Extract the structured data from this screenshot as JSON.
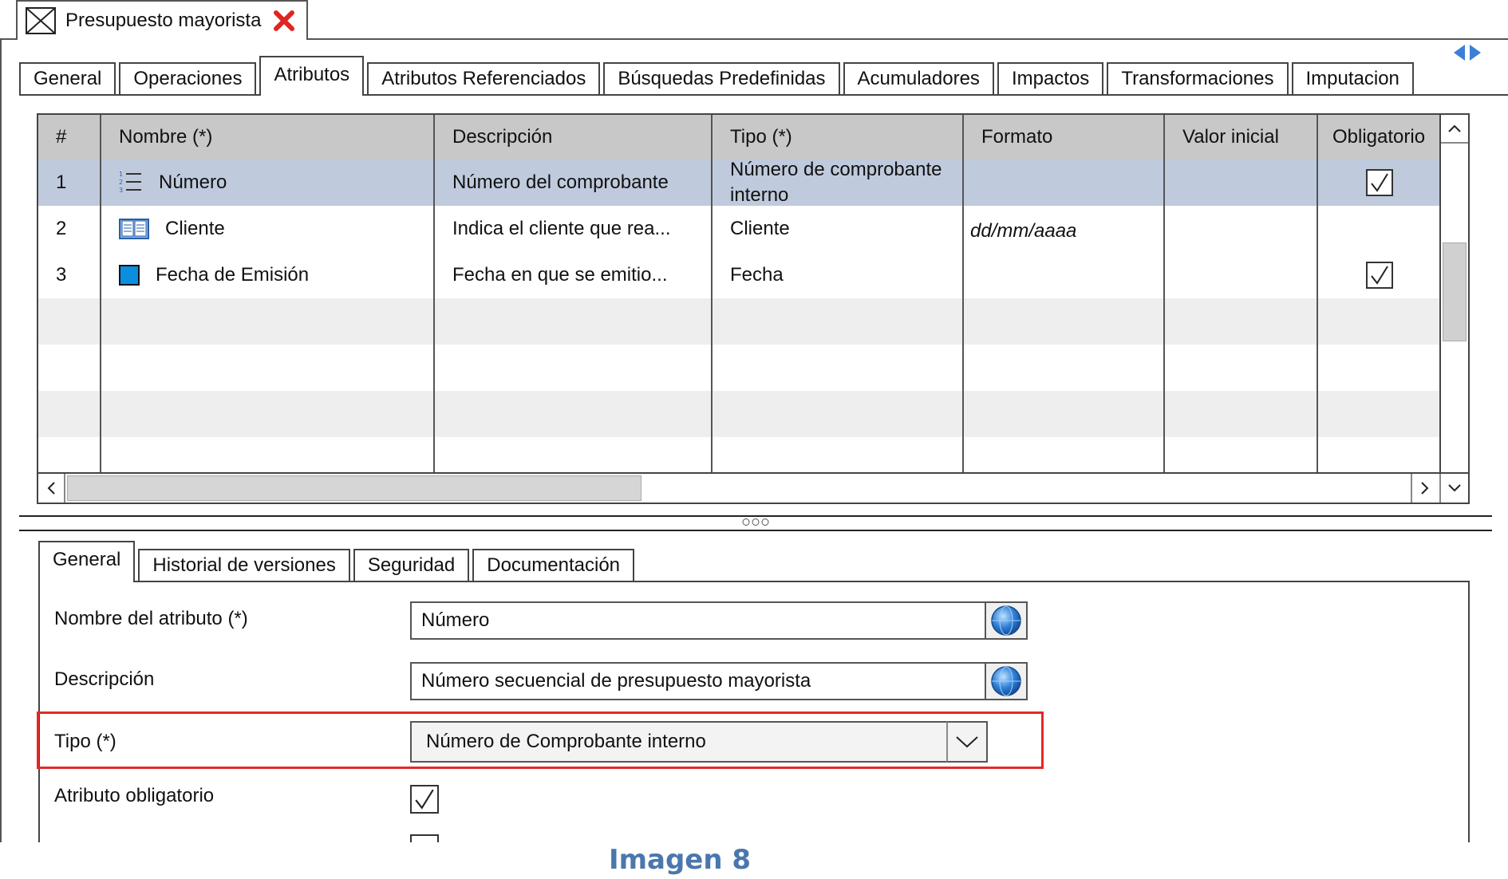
{
  "window": {
    "doc_title": "Presupuesto mayorista"
  },
  "tabs_top": [
    "General",
    "Operaciones",
    "Atributos",
    "Atributos Referenciados",
    "Búsquedas Predefinidas",
    "Acumuladores",
    "Impactos",
    "Transformaciones",
    "Imputacion"
  ],
  "tabs_top_active": "Atributos",
  "grid": {
    "columns": [
      "#",
      "Nombre (*)",
      "Descripción",
      "Tipo (*)",
      "Formato",
      "Valor inicial",
      "Obligatorio"
    ],
    "rows": [
      {
        "num": "1",
        "icon": "numbered-list-icon",
        "name": "Número",
        "desc": "Número del comprobante",
        "tipo": "Número de comprobante interno",
        "formato": "",
        "valor_inicial": "",
        "obligatorio": true,
        "selected": true
      },
      {
        "num": "2",
        "icon": "book-icon",
        "name": "Cliente",
        "desc": "Indica el cliente que rea...",
        "tipo": "Cliente",
        "formato": "dd/mm/aaaa",
        "valor_inicial": "",
        "obligatorio": false,
        "selected": false
      },
      {
        "num": "3",
        "icon": "blue-square-icon",
        "name": "Fecha de Emisión",
        "desc": "Fecha en que se emitio...",
        "tipo": "Fecha",
        "formato": "",
        "valor_inicial": "",
        "obligatorio": true,
        "selected": false
      }
    ]
  },
  "tabs_bottom": [
    "General",
    "Historial de versiones",
    "Seguridad",
    "Documentación"
  ],
  "tabs_bottom_active": "General",
  "form": {
    "nombre_label": "Nombre del atributo (*)",
    "nombre_value": "Número",
    "descripcion_label": "Descripción",
    "descripcion_value": "Número secuencial de presupuesto mayorista",
    "tipo_label": "Tipo (*)",
    "tipo_value": "Número de Comprobante interno",
    "obligatorio_label": "Atributo obligatorio",
    "obligatorio_checked": true
  },
  "caption": "Imagen 8",
  "colors": {
    "selected_row": "#c0cadd",
    "header_bg": "#c8c8c8",
    "highlight_border": "#e32929",
    "caption": "#4a77ad"
  }
}
